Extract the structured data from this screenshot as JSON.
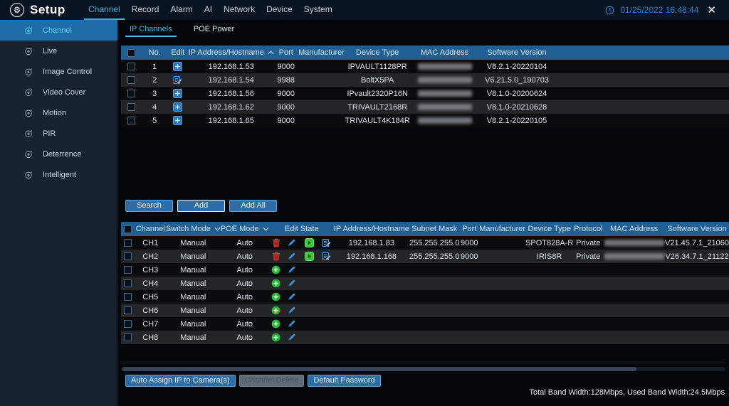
{
  "topbar": {
    "title": "Setup",
    "menu": [
      "Channel",
      "Record",
      "Alarm",
      "AI",
      "Network",
      "Device",
      "System"
    ],
    "active_menu": "Channel",
    "datetime": "01/25/2022 16:48:44",
    "close_glyph": "✕"
  },
  "sidebar": {
    "items": [
      {
        "label": "Channel",
        "active": true
      },
      {
        "label": "Live",
        "active": false
      },
      {
        "label": "Image Control",
        "active": false
      },
      {
        "label": "Video Cover",
        "active": false
      },
      {
        "label": "Motion",
        "active": false
      },
      {
        "label": "PIR",
        "active": false
      },
      {
        "label": "Deterrence",
        "active": false
      },
      {
        "label": "Intelligent",
        "active": false
      }
    ]
  },
  "tabs": [
    {
      "label": "IP Channels",
      "active": true
    },
    {
      "label": "POE Power",
      "active": false
    }
  ],
  "discovered_table": {
    "headers": [
      {
        "label": "No."
      },
      {
        "label": "Edit"
      },
      {
        "label": "IP Address/Hostname",
        "sort": "asc"
      },
      {
        "label": "Port"
      },
      {
        "label": "Manufacturer"
      },
      {
        "label": "Device Type"
      },
      {
        "label": "MAC Address"
      },
      {
        "label": "Software Version"
      }
    ],
    "rows": [
      {
        "no": "1",
        "edit_icon": "add-square",
        "ip": "192.168.1.53",
        "port": "9000",
        "manufacturer": "",
        "device_type": "IPVAULT1128PR",
        "mac_redacted": true,
        "software_version": "V8.2.1-20220104"
      },
      {
        "no": "2",
        "edit_icon": "edit-doc",
        "ip": "192.168.1.54",
        "port": "9988",
        "manufacturer": "",
        "device_type": "BoltX5PA",
        "mac_redacted": true,
        "software_version": "V6.21.5.0_190703"
      },
      {
        "no": "3",
        "edit_icon": "add-square",
        "ip": "192.168.1.56",
        "port": "9000",
        "manufacturer": "",
        "device_type": "IPvault2320P16N",
        "mac_redacted": true,
        "software_version": "V8.1.0-20200624"
      },
      {
        "no": "4",
        "edit_icon": "add-square",
        "ip": "192.168.1.62",
        "port": "9000",
        "manufacturer": "",
        "device_type": "TRIVAULT2168R",
        "mac_redacted": true,
        "software_version": "V8.1.0-20210628"
      },
      {
        "no": "5",
        "edit_icon": "add-square",
        "ip": "192.168.1.65",
        "port": "9000",
        "manufacturer": "",
        "device_type": "TRIVAULT4K184R",
        "mac_redacted": true,
        "software_version": "V8.2.1-20220105"
      }
    ]
  },
  "search_buttons": {
    "search": "Search",
    "add": "Add",
    "add_all": "Add All"
  },
  "channel_table": {
    "headers": [
      {
        "label": "Channel"
      },
      {
        "label": "Switch Mode",
        "dropdown": true
      },
      {
        "label": "POE Mode",
        "dropdown": true
      },
      {
        "label": ""
      },
      {
        "label": "Edit"
      },
      {
        "label": "State"
      },
      {
        "label": ""
      },
      {
        "label": "IP Address/Hostname"
      },
      {
        "label": "Subnet Mask"
      },
      {
        "label": "Port"
      },
      {
        "label": "Manufacturer"
      },
      {
        "label": "Device Type"
      },
      {
        "label": "Protocol"
      },
      {
        "label": "MAC Address"
      },
      {
        "label": "Software Version"
      }
    ],
    "rows": [
      {
        "channel": "CH1",
        "switch_mode": "Manual",
        "poe_mode": "Auto",
        "action_icon": "trash",
        "edit_icon": "pencil",
        "state_icon": "play",
        "config_icon": "edit-doc",
        "ip": "192.168.1.83",
        "subnet_mask": "255.255.255.0",
        "port": "9000",
        "manufacturer": "",
        "device_type": "SPOT828A-R",
        "protocol": "Private",
        "mac_redacted": true,
        "software_version": "V21.45.7.1_21060"
      },
      {
        "channel": "CH2",
        "switch_mode": "Manual",
        "poe_mode": "Auto",
        "action_icon": "trash",
        "edit_icon": "pencil",
        "state_icon": "play",
        "config_icon": "edit-doc",
        "ip": "192.168.1.168",
        "subnet_mask": "255.255.255.0",
        "port": "9000",
        "manufacturer": "",
        "device_type": "IRIS8R",
        "protocol": "Private",
        "mac_redacted": true,
        "software_version": "V26.34.7.1_21122"
      },
      {
        "channel": "CH3",
        "switch_mode": "Manual",
        "poe_mode": "Auto",
        "action_icon": "plus-circle",
        "edit_icon": "pencil",
        "state_icon": "",
        "config_icon": "",
        "ip": "",
        "subnet_mask": "",
        "port": "",
        "manufacturer": "",
        "device_type": "",
        "protocol": "",
        "mac_redacted": false,
        "software_version": ""
      },
      {
        "channel": "CH4",
        "switch_mode": "Manual",
        "poe_mode": "Auto",
        "action_icon": "plus-circle",
        "edit_icon": "pencil",
        "state_icon": "",
        "config_icon": "",
        "ip": "",
        "subnet_mask": "",
        "port": "",
        "manufacturer": "",
        "device_type": "",
        "protocol": "",
        "mac_redacted": false,
        "software_version": ""
      },
      {
        "channel": "CH5",
        "switch_mode": "Manual",
        "poe_mode": "Auto",
        "action_icon": "plus-circle",
        "edit_icon": "pencil",
        "state_icon": "",
        "config_icon": "",
        "ip": "",
        "subnet_mask": "",
        "port": "",
        "manufacturer": "",
        "device_type": "",
        "protocol": "",
        "mac_redacted": false,
        "software_version": ""
      },
      {
        "channel": "CH6",
        "switch_mode": "Manual",
        "poe_mode": "Auto",
        "action_icon": "plus-circle",
        "edit_icon": "pencil",
        "state_icon": "",
        "config_icon": "",
        "ip": "",
        "subnet_mask": "",
        "port": "",
        "manufacturer": "",
        "device_type": "",
        "protocol": "",
        "mac_redacted": false,
        "software_version": ""
      },
      {
        "channel": "CH7",
        "switch_mode": "Manual",
        "poe_mode": "Auto",
        "action_icon": "plus-circle",
        "edit_icon": "pencil",
        "state_icon": "",
        "config_icon": "",
        "ip": "",
        "subnet_mask": "",
        "port": "",
        "manufacturer": "",
        "device_type": "",
        "protocol": "",
        "mac_redacted": false,
        "software_version": ""
      },
      {
        "channel": "CH8",
        "switch_mode": "Manual",
        "poe_mode": "Auto",
        "action_icon": "plus-circle",
        "edit_icon": "pencil",
        "state_icon": "",
        "config_icon": "",
        "ip": "",
        "subnet_mask": "",
        "port": "",
        "manufacturer": "",
        "device_type": "",
        "protocol": "",
        "mac_redacted": false,
        "software_version": ""
      }
    ]
  },
  "footer": {
    "auto_assign": "Auto Assign IP to Camera(s)",
    "channel_delete": "Channel Delete",
    "default_password": "Default Password",
    "bandwidth": "Total Band Width:128Mbps, Used Band Width:24.5Mbps"
  },
  "colors": {
    "accent_cyan": "#3fb9d9",
    "table_header_blue": "#1f5f94",
    "button_blue": "#2e6ea8",
    "active_sidebar_blue": "#1f6da6",
    "datetime_blue": "#2f7dc8"
  }
}
